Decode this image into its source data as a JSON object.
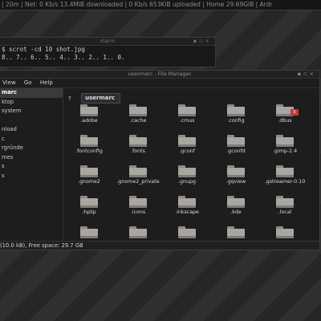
{
  "status_bar": {
    "text": "| 20m | Net: 0 Kb/s 13.4MiB downloaded | 0 Kb/s 653KiB uploaded | Home 29.69GiB | Ardr"
  },
  "terminal": {
    "title": "xterm",
    "lines": [
      "$ scrot -cd 10 shot.jpg",
      "8.. 7.. 6.. 5.. 4.. 3.. 2.. 1.. 0."
    ]
  },
  "file_manager": {
    "title": "usermarc - File Manager",
    "menu": [
      "View",
      "Go",
      "Help"
    ],
    "sidebar": [
      {
        "label": "marc",
        "active": true
      },
      {
        "label": "ktop",
        "active": false
      },
      {
        "label": "system",
        "active": false
      },
      {
        "label": "",
        "active": false
      },
      {
        "label": "nload",
        "active": false
      },
      {
        "label": "c",
        "active": false
      },
      {
        "label": "rgründe",
        "active": false
      },
      {
        "label": "mes",
        "active": false
      },
      {
        "label": "s",
        "active": false
      },
      {
        "label": "s",
        "active": false
      }
    ],
    "path": {
      "up_icon": "↑",
      "current": "usermarc"
    },
    "files": [
      {
        "name": ".adobe"
      },
      {
        "name": ".cache"
      },
      {
        "name": ".cmus"
      },
      {
        "name": ".config"
      },
      {
        "name": ".dbus",
        "emblem": "x"
      },
      {
        "name": ".fontconfig"
      },
      {
        "name": ".fonts"
      },
      {
        "name": ".gconf"
      },
      {
        "name": ".gconfd"
      },
      {
        "name": ".gimp-2.4"
      },
      {
        "name": ".gnome2"
      },
      {
        "name": ".gnome2_private"
      },
      {
        "name": ".gnupg"
      },
      {
        "name": ".gqview"
      },
      {
        "name": ".gstreamer-0.10"
      },
      {
        "name": ".hplip"
      },
      {
        "name": ".icons"
      },
      {
        "name": ".inkscape"
      },
      {
        "name": ".kde"
      },
      {
        "name": ".local"
      },
      {
        "name": ""
      },
      {
        "name": ""
      },
      {
        "name": ""
      },
      {
        "name": ""
      },
      {
        "name": ""
      }
    ],
    "status": "(10.0 kB), Free space: 29.7 GB"
  }
}
